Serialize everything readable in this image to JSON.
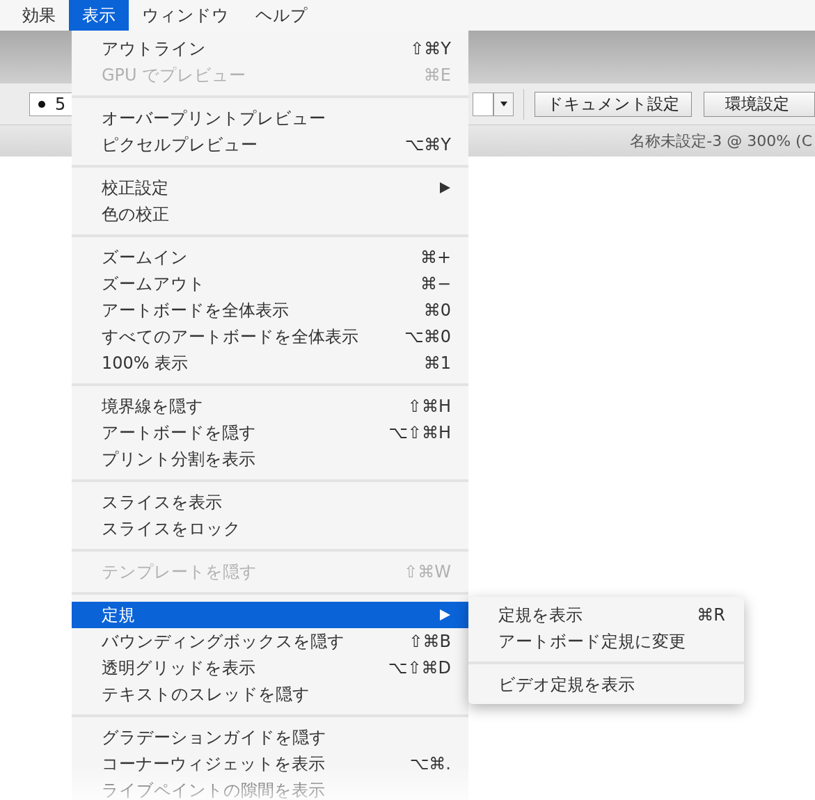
{
  "menubar": [
    {
      "label": "効果",
      "selected": false
    },
    {
      "label": "表示",
      "selected": true
    },
    {
      "label": "ウィンドウ",
      "selected": false
    },
    {
      "label": "ヘルプ",
      "selected": false
    }
  ],
  "toolbar": {
    "stroke_field": {
      "value": "5"
    },
    "buttons": [
      "ドキュメント設定",
      "環境設定"
    ]
  },
  "status_bar": {
    "document": "名称未設定-3 @ 300% (C"
  },
  "menu": {
    "groups": [
      [
        {
          "label": "アウトライン",
          "shortcut": "⇧⌘Y",
          "disabled": false,
          "selected": false,
          "submenu": false
        },
        {
          "label": "GPU でプレビュー",
          "shortcut": "⌘E",
          "disabled": true,
          "selected": false,
          "submenu": false
        }
      ],
      [
        {
          "label": "オーバープリントプレビュー",
          "disabled": false,
          "selected": false,
          "submenu": false
        },
        {
          "label": "ピクセルプレビュー",
          "shortcut": "⌥⌘Y",
          "disabled": false,
          "selected": false,
          "submenu": false
        }
      ],
      [
        {
          "label": "校正設定",
          "disabled": false,
          "selected": false,
          "submenu": true
        },
        {
          "label": "色の校正",
          "disabled": false,
          "selected": false,
          "submenu": false
        }
      ],
      [
        {
          "label": "ズームイン",
          "shortcut": "⌘+",
          "disabled": false,
          "selected": false,
          "submenu": false
        },
        {
          "label": "ズームアウト",
          "shortcut": "⌘−",
          "disabled": false,
          "selected": false,
          "submenu": false
        },
        {
          "label": "アートボードを全体表示",
          "shortcut": "⌘0",
          "disabled": false,
          "selected": false,
          "submenu": false
        },
        {
          "label": "すべてのアートボードを全体表示",
          "shortcut": "⌥⌘0",
          "disabled": false,
          "selected": false,
          "submenu": false
        },
        {
          "label": "100% 表示",
          "shortcut": "⌘1",
          "disabled": false,
          "selected": false,
          "submenu": false
        }
      ],
      [
        {
          "label": "境界線を隠す",
          "shortcut": "⇧⌘H",
          "disabled": false,
          "selected": false,
          "submenu": false
        },
        {
          "label": "アートボードを隠す",
          "shortcut": "⌥⇧⌘H",
          "disabled": false,
          "selected": false,
          "submenu": false
        },
        {
          "label": "プリント分割を表示",
          "disabled": false,
          "selected": false,
          "submenu": false
        }
      ],
      [
        {
          "label": "スライスを表示",
          "disabled": false,
          "selected": false,
          "submenu": false
        },
        {
          "label": "スライスをロック",
          "disabled": false,
          "selected": false,
          "submenu": false
        }
      ],
      [
        {
          "label": "テンプレートを隠す",
          "shortcut": "⇧⌘W",
          "disabled": true,
          "selected": false,
          "submenu": false
        }
      ],
      [
        {
          "label": "定規",
          "disabled": false,
          "selected": true,
          "submenu": true
        },
        {
          "label": "バウンディングボックスを隠す",
          "shortcut": "⇧⌘B",
          "disabled": false,
          "selected": false,
          "submenu": false
        },
        {
          "label": "透明グリッドを表示",
          "shortcut": "⌥⇧⌘D",
          "disabled": false,
          "selected": false,
          "submenu": false
        },
        {
          "label": "テキストのスレッドを隠す",
          "disabled": false,
          "selected": false,
          "submenu": false
        }
      ],
      [
        {
          "label": "グラデーションガイドを隠す",
          "disabled": false,
          "selected": false,
          "submenu": false
        },
        {
          "label": "コーナーウィジェットを表示",
          "shortcut": "⌥⌘.",
          "disabled": false,
          "selected": false,
          "submenu": false
        },
        {
          "label": "ライブペイントの隙間を表示",
          "disabled": false,
          "selected": false,
          "submenu": false
        }
      ]
    ]
  },
  "submenu": {
    "groups": [
      [
        {
          "label": "定規を表示",
          "shortcut": "⌘R"
        },
        {
          "label": "アートボード定規に変更"
        }
      ],
      [
        {
          "label": "ビデオ定規を表示"
        }
      ]
    ]
  }
}
